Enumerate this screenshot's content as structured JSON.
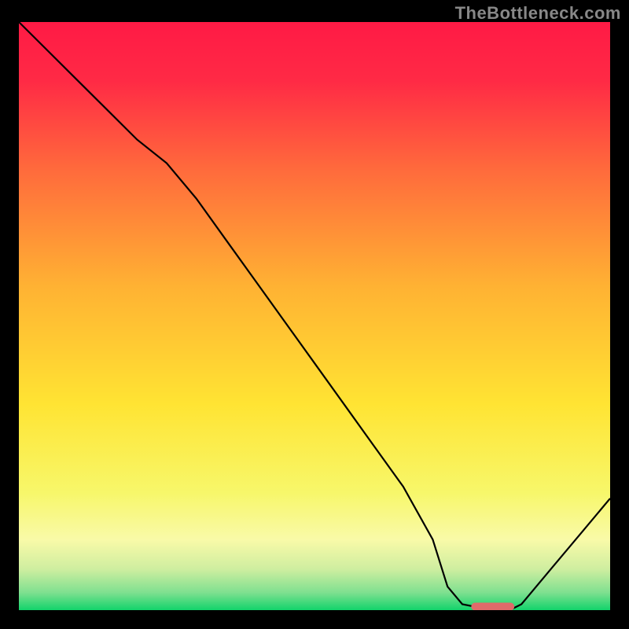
{
  "watermark": "TheBottleneck.com",
  "chart_data": {
    "type": "line",
    "x": [
      0.0,
      0.05,
      0.1,
      0.15,
      0.2,
      0.25,
      0.3,
      0.35,
      0.4,
      0.45,
      0.5,
      0.55,
      0.6,
      0.65,
      0.7,
      0.725,
      0.75,
      0.8,
      0.83,
      0.85,
      0.9,
      0.95,
      1.0
    ],
    "values": [
      1.0,
      0.95,
      0.9,
      0.85,
      0.8,
      0.76,
      0.7,
      0.63,
      0.56,
      0.49,
      0.42,
      0.35,
      0.28,
      0.21,
      0.12,
      0.04,
      0.01,
      0.0,
      0.0,
      0.01,
      0.07,
      0.13,
      0.19
    ],
    "marker": {
      "x": [
        0.765,
        0.838
      ],
      "y": 0.006
    },
    "title": "",
    "xlabel": "",
    "ylabel": "",
    "xlim": [
      0,
      1
    ],
    "ylim": [
      0,
      1
    ],
    "background_gradient": {
      "stops": [
        {
          "offset": 0.0,
          "color": "#ff1a45"
        },
        {
          "offset": 0.1,
          "color": "#ff2a45"
        },
        {
          "offset": 0.25,
          "color": "#ff6a3c"
        },
        {
          "offset": 0.45,
          "color": "#ffb233"
        },
        {
          "offset": 0.65,
          "color": "#ffe433"
        },
        {
          "offset": 0.8,
          "color": "#f7f76a"
        },
        {
          "offset": 0.88,
          "color": "#f9faa8"
        },
        {
          "offset": 0.93,
          "color": "#cfeea0"
        },
        {
          "offset": 0.97,
          "color": "#7fe090"
        },
        {
          "offset": 1.0,
          "color": "#12d36b"
        }
      ]
    }
  }
}
